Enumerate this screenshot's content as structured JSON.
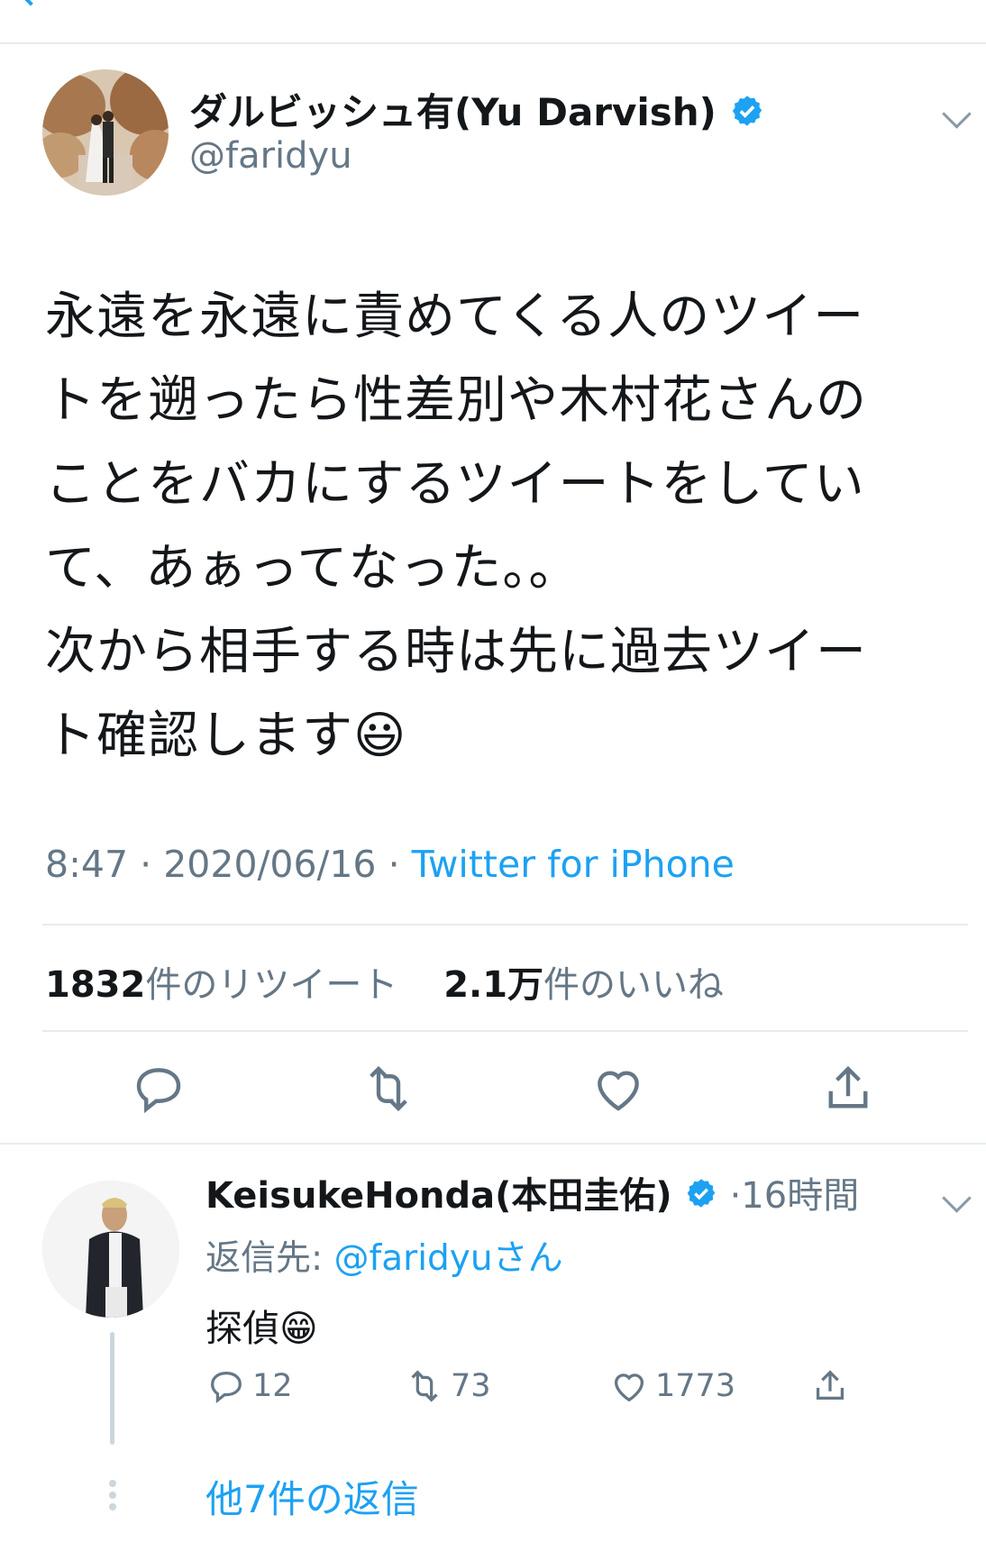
{
  "colors": {
    "accent": "#1da1f2",
    "text": "#14171a",
    "muted": "#657786",
    "divider": "#e6ecf0"
  },
  "main_tweet": {
    "display_name": "ダルビッシュ有(Yu Darvish)",
    "handle": "@faridyu",
    "text": "永遠を永遠に責めてくる人のツイー\nトを遡ったら性差別や木村花さんの\nことをバカにするツイートをしてい\nて、あぁってなった。。\n次から相手する時は先に過去ツイー\nト確認します😃",
    "time": "8:47",
    "date": "2020/06/16",
    "source": "Twitter for iPhone",
    "retweet_count": "1832",
    "retweet_label": "件のリツイート",
    "like_count": "2.1万",
    "like_label": "件のいいね",
    "icons": [
      "reply-icon",
      "retweet-icon",
      "like-icon",
      "share-icon"
    ]
  },
  "reply": {
    "display_name": "KeisukeHonda(本田圭佑)",
    "time_ago": "16時間",
    "reply_to_label": "返信先:",
    "reply_to_handle": "@faridyuさん",
    "text": "探偵😁",
    "reply_count": "12",
    "retweet_count": "73",
    "like_count": "1773"
  },
  "more_replies": "他7件の返信"
}
